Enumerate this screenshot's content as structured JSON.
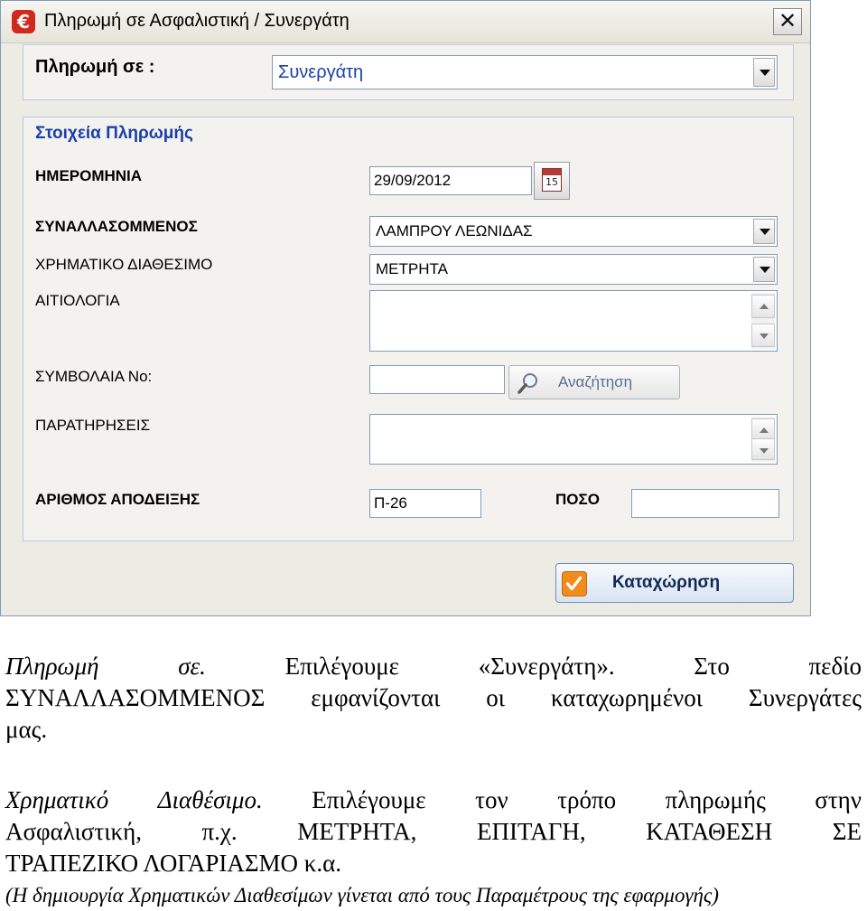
{
  "window": {
    "title": "Πληρωμή σε Ασφαλιστική / Συνεργάτη",
    "app_icon_glyph": "€",
    "close_glyph": "✕"
  },
  "pay_to": {
    "label": "Πληρωμή σε :",
    "value": "Συνεργάτη"
  },
  "group_title": "Στοιχεία Πληρωμής",
  "fields": {
    "date_label": "ΗΜΕΡΟΜΗΝΙΑ",
    "date_value": "29/09/2012",
    "calendar_day": "15",
    "counterparty_label": "ΣΥΝΑΛΛΑΣΟΜΜΕΝΟΣ",
    "counterparty_value": "ΛΑΜΠΡΟΥ ΛΕΩΝΙΔΑΣ",
    "cash_label": "ΧΡΗΜΑΤΙΚΟ ΔΙΑΘΕΣΙΜΟ",
    "cash_value": "ΜΕΤΡΗΤΑ",
    "reason_label": "ΑΙΤΙΟΛΟΓΙΑ",
    "contracts_label": "ΣΥΜΒΟΛΑΙΑ Νο:",
    "contracts_value": "",
    "search_label": "Αναζήτηση",
    "remarks_label": "ΠΑΡΑΤΗΡΗΣΕΙΣ",
    "receipt_label": "ΑΡΙΘΜΟΣ ΑΠΟΔΕΙΞΗΣ",
    "receipt_value": "Π-26",
    "amount_label": "ΠΟΣΟ",
    "amount_value": ""
  },
  "save_label": "Καταχώρηση",
  "caption": {
    "p1_l1": [
      "Πληρωμή",
      "σε.",
      "Επιλέγουμε",
      "«Συνεργάτη».",
      "Στο",
      "πεδίο"
    ],
    "p1_l2": [
      "ΣΥΝΑΛΛΑΣΟΜΜΕΝΟΣ",
      "εμφανίζονται",
      "οι",
      "καταχωρημένοι",
      "Συνεργάτες"
    ],
    "p1_l3": "μας.",
    "p2_l1": [
      "Χρηματικό",
      "Διαθέσιμο.",
      "Επιλέγουμε",
      "τον",
      "τρόπο",
      "πληρωμής",
      "στην"
    ],
    "p2_l2": [
      "Ασφαλιστική,",
      "π.χ.",
      "ΜΕΤΡΗΤΑ,",
      "ΕΠΙΤΑΓΗ,",
      "ΚΑΤΑΘΕΣΗ",
      "ΣΕ"
    ],
    "p2_l3": "ΤΡΑΠΕΖΙΚΟ ΛΟΓΑΡΙΑΣΜΟ κ.α.",
    "p2_l4": "(Η δημιουργία Χρηματικών Διαθεσίμων γίνεται από τους Παραμέτρους της εφαρμογής)"
  }
}
